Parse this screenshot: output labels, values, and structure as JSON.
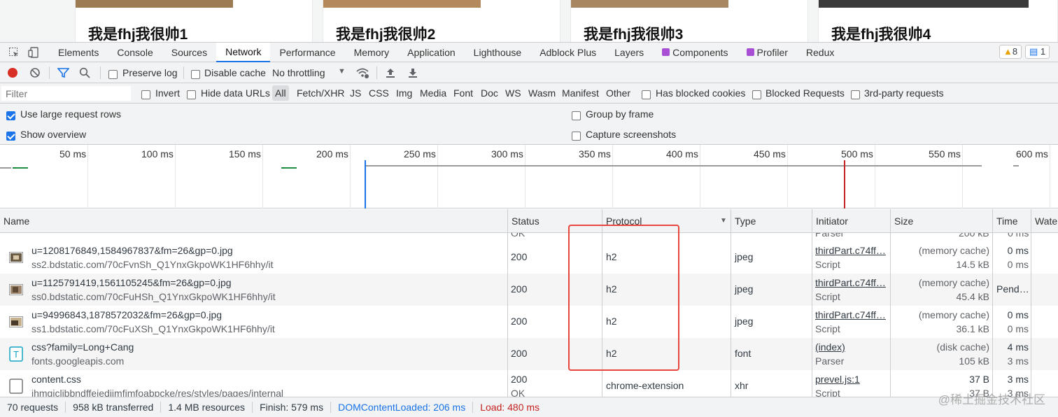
{
  "page_preview": {
    "cards": [
      "我是fhj我很帅1",
      "我是fhj我很帅2",
      "我是fhj我很帅3",
      "我是fhj我很帅4"
    ]
  },
  "tabs": [
    "Elements",
    "Console",
    "Sources",
    "Network",
    "Performance",
    "Memory",
    "Application",
    "Lighthouse",
    "Adblock Plus",
    "Layers",
    "Components",
    "Profiler",
    "Redux"
  ],
  "active_tab": "Network",
  "badges": {
    "warnings": "8",
    "messages": "1"
  },
  "toolbar": {
    "preserve_log": "Preserve log",
    "disable_cache": "Disable cache",
    "throttling": "No throttling"
  },
  "filter": {
    "placeholder": "Filter",
    "invert": "Invert",
    "hide_data_urls": "Hide data URLs",
    "types": [
      "All",
      "Fetch/XHR",
      "JS",
      "CSS",
      "Img",
      "Media",
      "Font",
      "Doc",
      "WS",
      "Wasm",
      "Manifest",
      "Other"
    ],
    "blocked_cookies": "Has blocked cookies",
    "blocked_requests": "Blocked Requests",
    "third_party": "3rd-party requests"
  },
  "settings": {
    "large_rows": "Use large request rows",
    "show_overview": "Show overview",
    "group_by_frame": "Group by frame",
    "capture_screenshots": "Capture screenshots"
  },
  "overview_ticks": [
    "50 ms",
    "100 ms",
    "150 ms",
    "200 ms",
    "250 ms",
    "300 ms",
    "350 ms",
    "400 ms",
    "450 ms",
    "500 ms",
    "550 ms",
    "600 ms"
  ],
  "columns": [
    "Name",
    "Status",
    "Protocol",
    "Type",
    "Initiator",
    "Size",
    "Time",
    "Waterfall"
  ],
  "column_labels": [
    "Name",
    "Status",
    "Protocol",
    "Type",
    "Initiator",
    "Size",
    "Time",
    "Wate"
  ],
  "partial_top": {
    "status": "OK",
    "initiator": "Parser",
    "size": "200 kB",
    "time": "0 ms"
  },
  "rows": [
    {
      "name": "u=1208176849,1584967837&fm=26&gp=0.jpg",
      "domain": "ss2.bdstatic.com/70cFvnSh_Q1YnxGkpoWK1HF6hhy/it",
      "status": "200",
      "protocol": "h2",
      "type": "jpeg",
      "initiator": "thirdPart.c74ff…",
      "initiator_type": "Script",
      "size1": "(memory cache)",
      "size2": "14.5 kB",
      "time1": "0 ms",
      "time2": "0 ms"
    },
    {
      "name": "u=1125791419,1561105245&fm=26&gp=0.jpg",
      "domain": "ss0.bdstatic.com/70cFuHSh_Q1YnxGkpoWK1HF6hhy/it",
      "status": "200",
      "protocol": "h2",
      "type": "jpeg",
      "initiator": "thirdPart.c74ff…",
      "initiator_type": "Script",
      "size1": "(memory cache)",
      "size2": "45.4 kB",
      "time1": "Pend…",
      "time2": ""
    },
    {
      "name": "u=94996843,1878572032&fm=26&gp=0.jpg",
      "domain": "ss1.bdstatic.com/70cFuXSh_Q1YnxGkpoWK1HF6hhy/it",
      "status": "200",
      "protocol": "h2",
      "type": "jpeg",
      "initiator": "thirdPart.c74ff…",
      "initiator_type": "Script",
      "size1": "(memory cache)",
      "size2": "36.1 kB",
      "time1": "0 ms",
      "time2": "0 ms"
    },
    {
      "name": "css?family=Long+Cang",
      "domain": "fonts.googleapis.com",
      "status": "200",
      "protocol": "h2",
      "type": "font",
      "initiator": "(index)",
      "initiator_type": "Parser",
      "size1": "(disk cache)",
      "size2": "105 kB",
      "time1": "4 ms",
      "time2": "3 ms"
    },
    {
      "name": "content.css",
      "domain": "jhmgjclibbndffeiedjimfimfoabpcke/res/styles/pages/internal",
      "status": "200",
      "status2": "OK",
      "protocol": "chrome-extension",
      "type": "xhr",
      "initiator": "prevel.js:1",
      "initiator_type": "Script",
      "size1": "37 B",
      "size2": "37 B",
      "time1": "3 ms",
      "time2": "3 ms"
    }
  ],
  "statusbar": {
    "requests": "70 requests",
    "transferred": "958 kB transferred",
    "resources": "1.4 MB resources",
    "finish": "Finish: 579 ms",
    "dcl": "DOMContentLoaded: 206 ms",
    "load": "Load: 480 ms"
  },
  "watermark": "@稀土掘金技术社区",
  "colors": {
    "accent": "#1a73e8",
    "dcl": "#1a73e8",
    "load": "#c5221f",
    "highlight_box": "#e8453c",
    "record": "#d93025"
  }
}
